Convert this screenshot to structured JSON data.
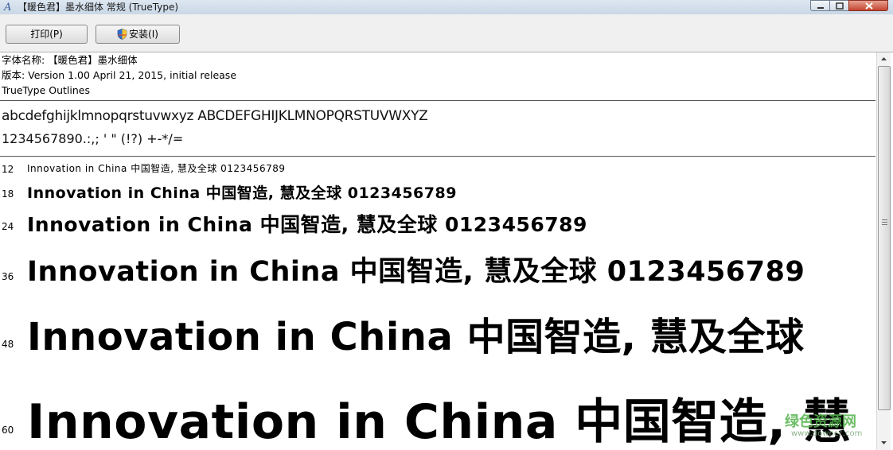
{
  "window": {
    "title": "【暖色君】墨水细体 常规 (TrueType)"
  },
  "toolbar": {
    "print_label": "打印(P)",
    "install_label": "安装(I)"
  },
  "font_info": {
    "name_line": "字体名称: 【暖色君】墨水细体",
    "version_line": "版本: Version 1.00 April 21, 2015, initial release",
    "outline_line": "TrueType Outlines"
  },
  "charset": {
    "letters": "abcdefghijklmnopqrstuvwxyz ABCDEFGHIJKLMNOPQRSTUVWXYZ",
    "digits": "1234567890.:,; ' \" (!?) +-*/="
  },
  "samples": [
    {
      "size": "12",
      "text": "Innovation in China 中国智造, 慧及全球 0123456789"
    },
    {
      "size": "18",
      "text": "Innovation in China 中国智造, 慧及全球 0123456789"
    },
    {
      "size": "24",
      "text": "Innovation in China 中国智造, 慧及全球 0123456789"
    },
    {
      "size": "36",
      "text": "Innovation in China 中国智造, 慧及全球 0123456789"
    },
    {
      "size": "48",
      "text": "Innovation in China 中国智造, 慧及全球"
    },
    {
      "size": "60",
      "text": "Innovation in China 中国智造, 慧"
    }
  ],
  "watermark": {
    "brand": "绿色资源网",
    "url": "www.downcc.com"
  }
}
